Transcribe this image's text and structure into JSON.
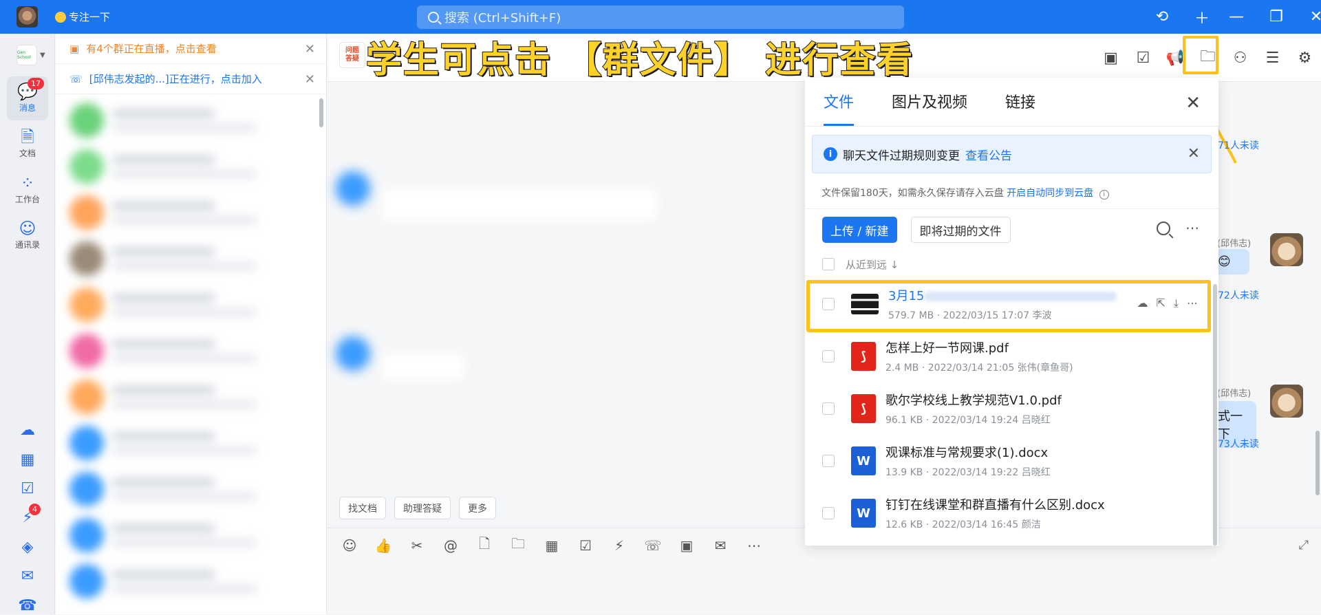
{
  "titlebar": {
    "status": "专注一下",
    "search_placeholder": "搜索 (Ctrl+Shift+F)",
    "icons": [
      "history-icon",
      "plus-icon",
      "minimize-icon",
      "restore-icon",
      "close-icon"
    ]
  },
  "leftnav": {
    "org_label": "Gen School",
    "items": [
      {
        "label": "消息",
        "badge": "17"
      },
      {
        "label": "文档"
      },
      {
        "label": "工作台"
      },
      {
        "label": "通讯录"
      }
    ],
    "bottom_badge": "4"
  },
  "notices": [
    {
      "text": "有4个群正在直播，点击查看"
    },
    {
      "text": "[邱伟志发起的...]正在进行，点击加入"
    }
  ],
  "chat": {
    "group_icon_text": "问题答疑",
    "banner": "学生可点击 【群文件】 进行查看",
    "quick_actions": [
      "找文档",
      "助理答疑",
      "更多"
    ],
    "messages_right": [
      {
        "sender": "东(邱伟志)",
        "text": "😊",
        "unread": "72人未读"
      },
      {
        "sender": "东(邱伟志)",
        "text": "式一下",
        "unread": "73人未读"
      }
    ],
    "top_unread": "71人未读"
  },
  "files_panel": {
    "tabs": [
      "文件",
      "图片及视频",
      "链接"
    ],
    "info_text": "聊天文件过期规则变更",
    "info_link": "查看公告",
    "note_text": "文件保留180天，如需永久保存请存入云盘",
    "note_link": "开启自动同步到云盘",
    "upload_btn": "上传 / 新建",
    "expiring_btn": "即将过期的文件",
    "sort_label": "从近到远 ↓",
    "files": [
      {
        "name": "3月15",
        "meta": "579.7 MB · 2022/03/15 17:07 李波",
        "type": "video"
      },
      {
        "name": "怎样上好一节网课.pdf",
        "meta": "2.4 MB · 2022/03/14 21:05 张伟(章鱼哥)",
        "type": "pdf"
      },
      {
        "name": "歌尔学校线上教学规范V1.0.pdf",
        "meta": "96.1 KB · 2022/03/14 19:24 吕晓红",
        "type": "pdf"
      },
      {
        "name": "观课标准与常规要求(1).docx",
        "meta": "13.9 KB · 2022/03/14 19:22 吕晓红",
        "type": "doc"
      },
      {
        "name": "钉钉在线课堂和群直播有什么区别.docx",
        "meta": "12.6 KB · 2022/03/14 16:45 颜洁",
        "type": "doc"
      }
    ]
  }
}
